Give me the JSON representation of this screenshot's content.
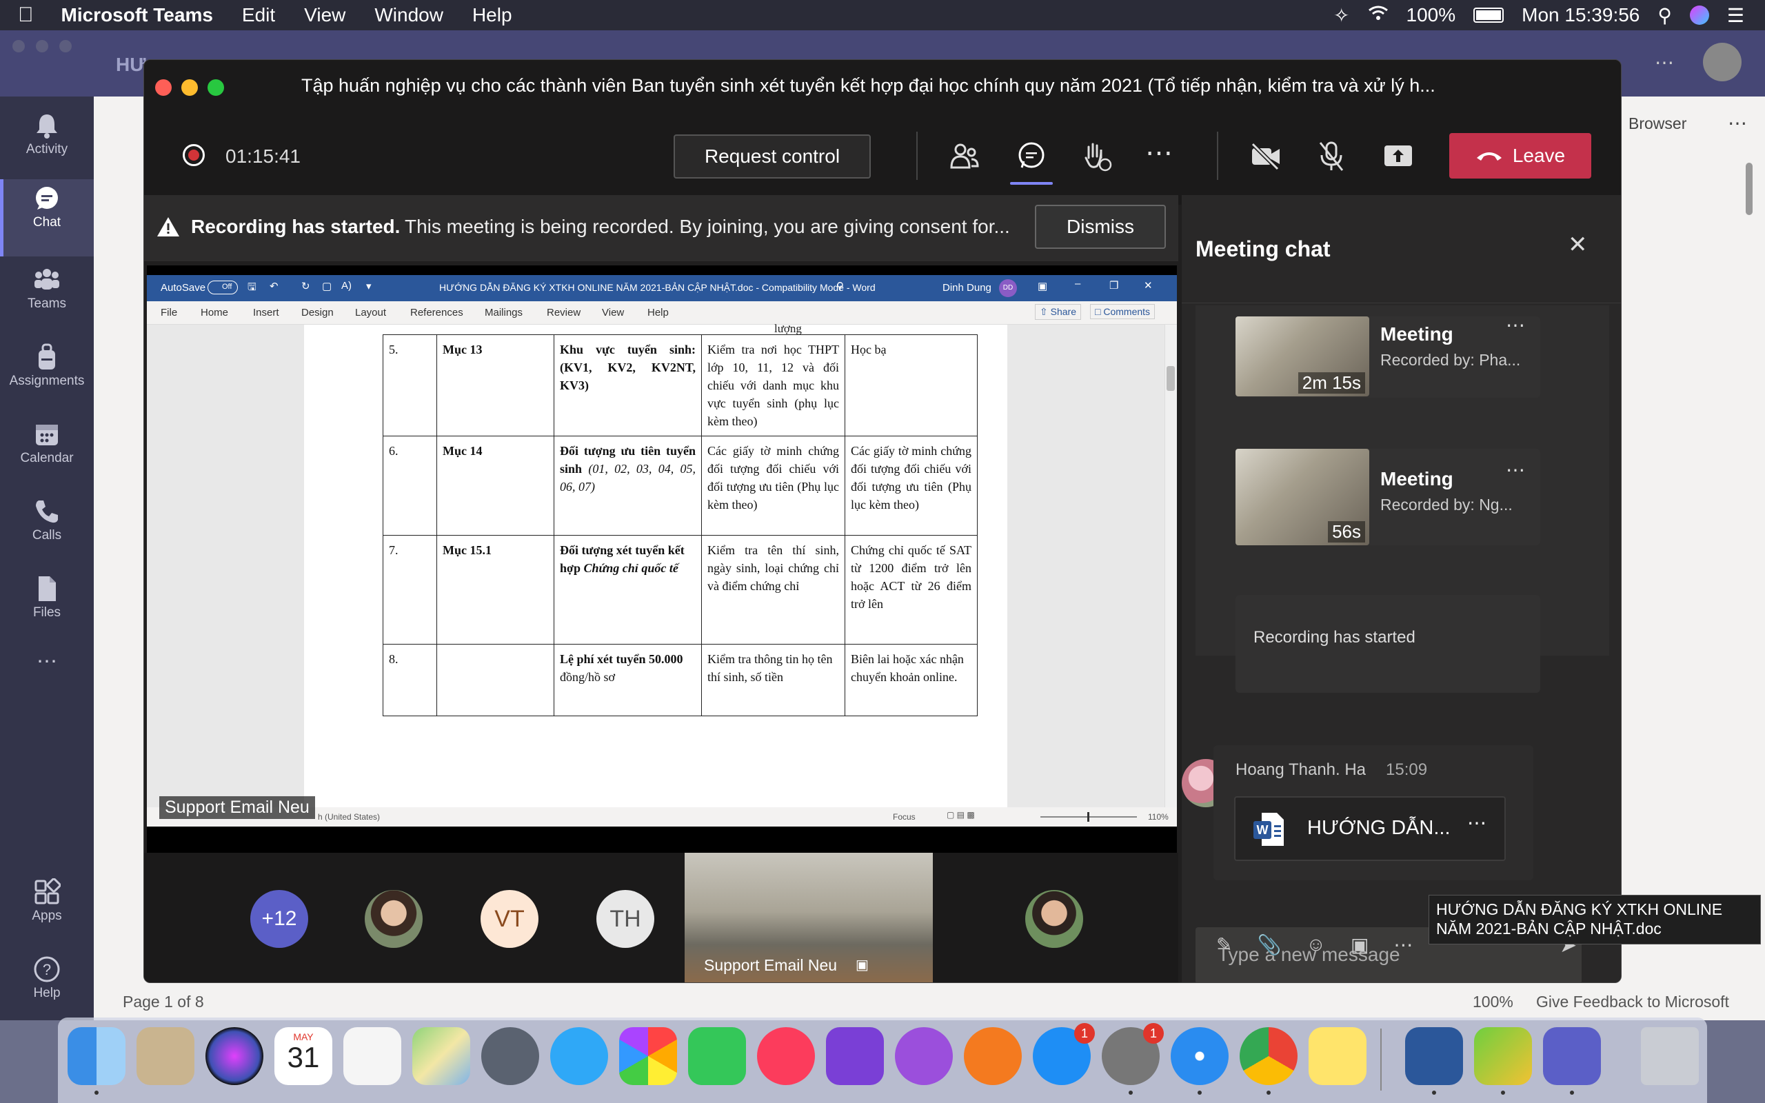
{
  "menubar": {
    "app_name": "Microsoft Teams",
    "items": [
      "Edit",
      "View",
      "Window",
      "Help"
    ],
    "battery": "100%",
    "clock": "Mon 15:39:56"
  },
  "background": {
    "title_fragment": "HƯ",
    "browser_label": "Browser",
    "status_page": "Page 1 of 8",
    "status_zoom": "100%",
    "status_feedback": "Give Feedback to Microsoft"
  },
  "rail": [
    {
      "label": "Activity",
      "icon": "bell-icon"
    },
    {
      "label": "Chat",
      "icon": "chat-icon"
    },
    {
      "label": "Teams",
      "icon": "teams-icon"
    },
    {
      "label": "Assignments",
      "icon": "backpack-icon"
    },
    {
      "label": "Calendar",
      "icon": "calendar-icon"
    },
    {
      "label": "Calls",
      "icon": "phone-icon"
    },
    {
      "label": "Files",
      "icon": "file-icon"
    },
    {
      "label": "Apps",
      "icon": "apps-icon"
    },
    {
      "label": "Help",
      "icon": "help-icon"
    }
  ],
  "meeting": {
    "title": "Tập huấn nghiệp vụ cho các thành viên Ban tuyển sinh xét tuyển kết hợp đại học chính quy năm 2021 (Tổ tiếp nhận, kiểm tra và xử lý h...",
    "timer": "01:15:41",
    "request_control": "Request control",
    "leave": "Leave",
    "banner_bold": "Recording has started.",
    "banner_text": "This meeting is being recorded. By joining, you are giving consent for...",
    "dismiss": "Dismiss",
    "presenter_label": "Support Email Neu",
    "gallery_more": "+12",
    "gallery_vt": "VT",
    "gallery_th": "TH",
    "video_label": "Support Email Neu"
  },
  "word": {
    "autosave": "AutoSave",
    "autosave_state": "Off",
    "title": "HƯỚNG DẪN ĐĂNG KÝ XTKH ONLINE NĂM 2021-BẢN CẬP NHẬT.doc  -  Compatibility Mode  -  Word",
    "user": "Dinh Dung",
    "user_initials": "DD",
    "tabs": [
      "File",
      "Home",
      "Insert",
      "Design",
      "Layout",
      "References",
      "Mailings",
      "Review",
      "View",
      "Help"
    ],
    "share": "Share",
    "comments": "Comments",
    "top_fragment": "lượng",
    "rows": [
      {
        "no": "5.",
        "item": "Mục 13",
        "field_bold": "Khu vực tuyển sinh: (KV1, KV2, KV2NT, KV3)",
        "field_italic": "",
        "check": "Kiểm tra nơi học THPT lớp 10, 11, 12 và đối chiếu với danh mục khu vực tuyển sinh (phụ lục kèm theo)",
        "doc": "Học bạ"
      },
      {
        "no": "6.",
        "item": "Mục 14",
        "field_bold": "Đối tượng ưu tiên tuyển sinh",
        "field_italic": "(01, 02, 03, 04, 05, 06, 07)",
        "check": "Các giấy tờ minh chứng đối tượng đối chiếu với đối tượng ưu tiên (Phụ lục kèm theo)",
        "doc": "Các giấy tờ minh chứng đối tượng đối chiếu với đối tượng ưu tiên (Phụ lục kèm theo)"
      },
      {
        "no": "7.",
        "item": "Mục 15.1",
        "field_bold": "Đối tượng xét tuyển kết hợp",
        "field_italic": "Chứng chỉ quốc tế",
        "check": "Kiểm tra tên thí sinh, ngày sinh, loại chứng chỉ và điểm chứng chỉ",
        "doc": "Chứng chỉ quốc tế SAT từ 1200 điểm trở lên hoặc ACT từ 26 điểm trở lên"
      },
      {
        "no": "8.",
        "item": "",
        "field_bold": "Lệ phí xét tuyển 50.000",
        "field_italic": "",
        "field_plain": "đồng/hồ sơ",
        "check": "Kiểm tra thông tin họ tên thí sinh, số tiền",
        "doc": "Biên lai hoặc xác nhận chuyển khoản online."
      }
    ],
    "status_lang": "h (United States)",
    "status_focus": "Focus",
    "status_zoom": "110%"
  },
  "chat": {
    "title": "Meeting chat",
    "recordings": [
      {
        "title": "Meeting",
        "by": "Recorded by: Pha...",
        "duration": "2m 15s"
      },
      {
        "title": "Meeting",
        "by": "Recorded by: Ng...",
        "duration": "56s"
      }
    ],
    "recording_started": "Recording has started",
    "message_author": "Hoang Thanh. Ha",
    "message_time": "15:09",
    "attachment": "HƯỚNG DẪN...",
    "compose_placeholder": "Type a new message",
    "tooltip": "HƯỚNG DẪN ĐĂNG KÝ XTKH ONLINE NĂM 2021-BẢN CẬP NHẬT.doc"
  },
  "dock": {
    "calendar_month": "MAY",
    "calendar_day": "31",
    "appstore_badge": "1",
    "settings_badge": "1"
  },
  "colors": {
    "teams_accent": "#7f85f5",
    "leave_red": "#c4314b",
    "word_blue": "#2b579a"
  }
}
